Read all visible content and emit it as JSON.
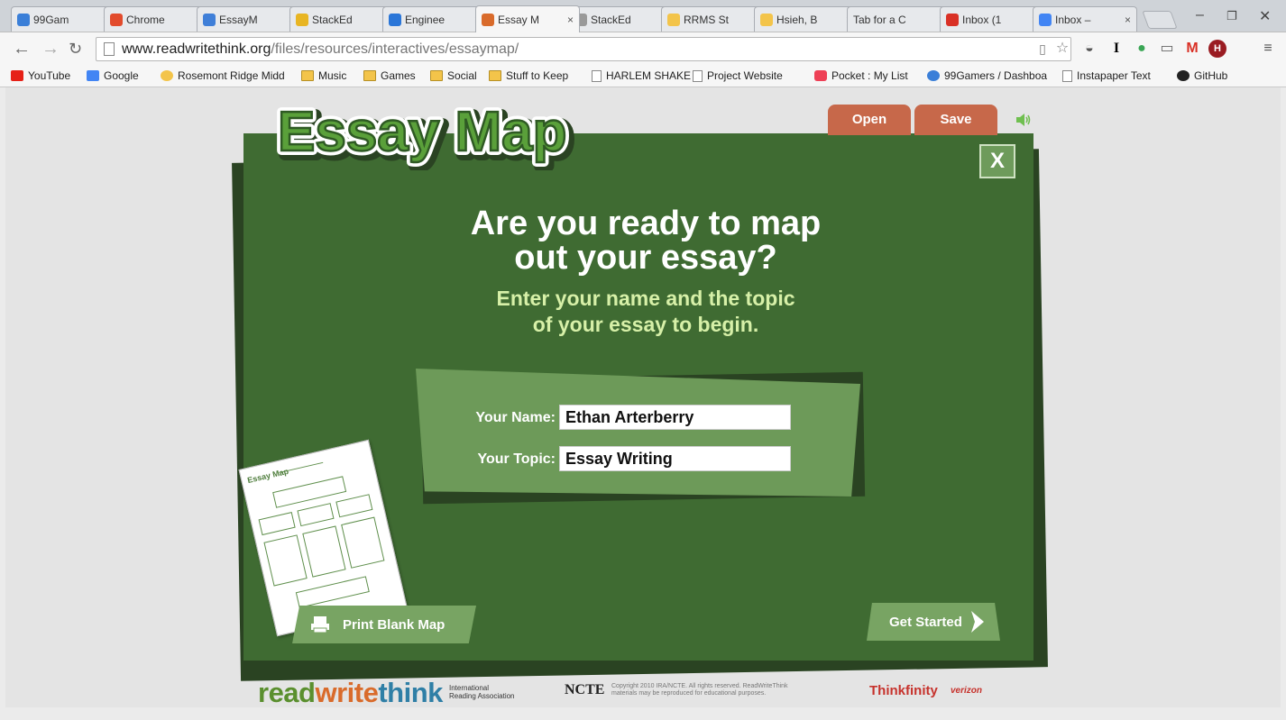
{
  "browser": {
    "tabs": [
      {
        "title": "99Gam",
        "favicon": "99gamers-icon",
        "color": "#3b7fd8"
      },
      {
        "title": "Chrome",
        "favicon": "chrome-web-store-icon",
        "color": "#e24b2c"
      },
      {
        "title": "EssayM",
        "favicon": "essaymap-icon",
        "color": "#3f7fd8"
      },
      {
        "title": "StackEd",
        "favicon": "stackedit-icon",
        "color": "#e8b523"
      },
      {
        "title": "Enginee",
        "favicon": "dropbox-icon",
        "color": "#2a76d8"
      },
      {
        "title": "Essay M",
        "favicon": "rwt-icon",
        "color": "#d96b2b",
        "active": true
      },
      {
        "title": "StackEd",
        "favicon": "document-icon",
        "color": "#999999"
      },
      {
        "title": "RRMS St",
        "favicon": "rrms-icon",
        "color": "#f3c44a"
      },
      {
        "title": "Hsieh, B",
        "favicon": "hsieh-icon",
        "color": "#f3c44a"
      },
      {
        "title": "Tab for a C",
        "favicon": "none",
        "color": ""
      },
      {
        "title": "Inbox (1",
        "favicon": "gmail-icon",
        "color": "#d93025"
      },
      {
        "title": "Inbox – ",
        "favicon": "inbox-icon",
        "color": "#4285f4"
      }
    ],
    "url_host": "www.readwritethink.org",
    "url_path": "/files/resources/interactives/essaymap/",
    "bookmarks": [
      {
        "label": "YouTube",
        "icon": "youtube-icon"
      },
      {
        "label": "Google",
        "icon": "google-icon"
      },
      {
        "label": "Rosemont Ridge Midd",
        "icon": "rrms-icon"
      },
      {
        "label": "Music",
        "icon": "folder-icon"
      },
      {
        "label": "Games",
        "icon": "folder-icon"
      },
      {
        "label": "Social",
        "icon": "folder-icon"
      },
      {
        "label": "Stuff to Keep",
        "icon": "folder-icon"
      },
      {
        "label": "HARLEM SHAKE",
        "icon": "document-icon"
      },
      {
        "label": "Project Website",
        "icon": "document-icon"
      },
      {
        "label": "Pocket : My List",
        "icon": "pocket-icon"
      },
      {
        "label": "99Gamers / Dashboa",
        "icon": "99gamers-icon"
      },
      {
        "label": "Instapaper Text",
        "icon": "document-icon"
      },
      {
        "label": "GitHub",
        "icon": "github-icon"
      }
    ]
  },
  "app": {
    "logo_text": "Essay Map",
    "open_label": "Open",
    "save_label": "Save",
    "close_label": "X",
    "headline_line1": "Are you ready to map",
    "headline_line2": "out your essay?",
    "subline_line1": "Enter your name and the topic",
    "subline_line2": "of your essay to begin.",
    "name_label": "Your Name:",
    "name_value": "Ethan Arterberry",
    "topic_label": "Your Topic:",
    "topic_value": "Essay Writing",
    "print_label": "Print Blank Map",
    "start_label": "Get Started",
    "thumb_logo": "Essay Map"
  },
  "footer": {
    "rwt_read": "read",
    "rwt_write": "write",
    "rwt_think": "think",
    "ira_line1": "International",
    "ira_line2": "Reading Association",
    "ncte": "NCTE",
    "copyright_line1": "Copyright 2010 IRA/NCTE. All rights reserved. ReadWriteThink",
    "copyright_line2": "materials may be reproduced for educational purposes.",
    "thinkfinity": "Thinkfinity",
    "verizon": "verizon"
  },
  "colors": {
    "board": "#3f6b32",
    "board_shadow": "#2a4322",
    "panel": "#6d9a59",
    "button_tab": "#c7684a",
    "subline": "#d7f0a8"
  }
}
